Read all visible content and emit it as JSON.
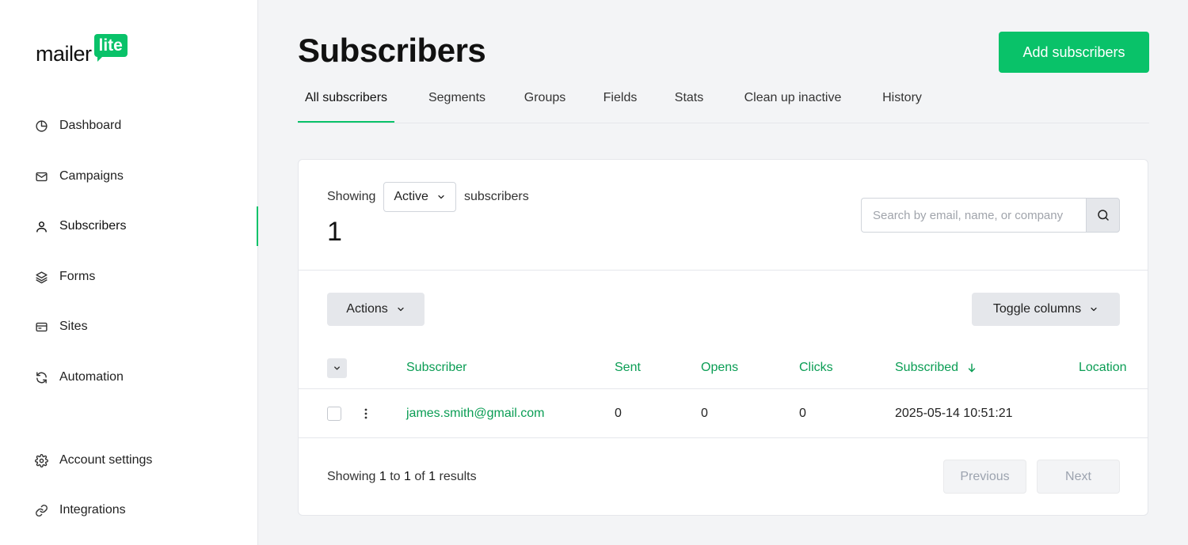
{
  "brand": {
    "logo_text": "mailer",
    "logo_badge": "lite",
    "accent": "#09c269",
    "link_color": "#0a9d54"
  },
  "sidebar": {
    "items": [
      {
        "label": "Dashboard",
        "icon": "pie-chart-icon"
      },
      {
        "label": "Campaigns",
        "icon": "mail-icon"
      },
      {
        "label": "Subscribers",
        "icon": "user-icon",
        "active": true
      },
      {
        "label": "Forms",
        "icon": "layers-icon"
      },
      {
        "label": "Sites",
        "icon": "browser-icon"
      },
      {
        "label": "Automation",
        "icon": "refresh-icon"
      }
    ],
    "bottom_items": [
      {
        "label": "Account settings",
        "icon": "gear-icon"
      },
      {
        "label": "Integrations",
        "icon": "link-icon"
      }
    ]
  },
  "header": {
    "title": "Subscribers",
    "add_button": "Add subscribers"
  },
  "tabs": [
    {
      "label": "All subscribers",
      "active": true
    },
    {
      "label": "Segments"
    },
    {
      "label": "Groups"
    },
    {
      "label": "Fields"
    },
    {
      "label": "Stats"
    },
    {
      "label": "Clean up inactive"
    },
    {
      "label": "History"
    }
  ],
  "summary": {
    "showing_label": "Showing",
    "status_selected": "Active",
    "suffix": "subscribers",
    "count": "1"
  },
  "search": {
    "placeholder": "Search by email, name, or company"
  },
  "toolbar": {
    "actions_label": "Actions",
    "toggle_columns_label": "Toggle columns"
  },
  "table": {
    "columns": [
      "Subscriber",
      "Sent",
      "Opens",
      "Clicks",
      "Subscribed",
      "Location"
    ],
    "rows": [
      {
        "email": "james.smith@gmail.com",
        "sent": "0",
        "opens": "0",
        "clicks": "0",
        "subscribed": "2025-05-14 10:51:21",
        "location": ""
      }
    ]
  },
  "pagination": {
    "showing": "Showing",
    "from": "1",
    "to_word": "to",
    "to": "1",
    "of_word": "of",
    "total": "1",
    "results_word": "results",
    "previous": "Previous",
    "next": "Next"
  }
}
